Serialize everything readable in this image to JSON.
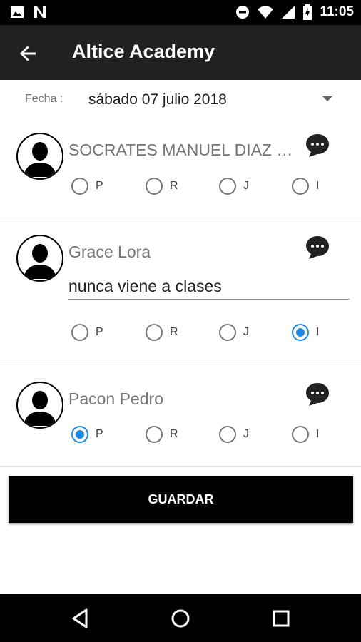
{
  "status_bar": {
    "time": "11:05",
    "left_icons": [
      "image-icon",
      "n-logo-icon"
    ],
    "right_icons": [
      "do-not-disturb-icon",
      "wifi-icon",
      "cell-signal-icon",
      "battery-charging-icon"
    ]
  },
  "app_bar": {
    "title": "Altice Academy",
    "back_icon": "arrow-back-icon"
  },
  "date_row": {
    "label": "Fecha :",
    "value": "sábado 07 julio 2018"
  },
  "attendance_options": [
    "P",
    "R",
    "J",
    "I"
  ],
  "students": [
    {
      "name": "SOCRATES MANUEL DIAZ RODRIGUEZ",
      "note": "",
      "selected": ""
    },
    {
      "name": "Grace Lora",
      "note": "nunca viene a clases",
      "selected": "I"
    },
    {
      "name": "Pacon Pedro",
      "note": "",
      "selected": "P"
    }
  ],
  "save_button": {
    "label": "GUARDAR"
  },
  "colors": {
    "app_bar": "#212121",
    "status_bar": "#000000",
    "radio_checked": "#1e88e5",
    "button": "#000000"
  }
}
